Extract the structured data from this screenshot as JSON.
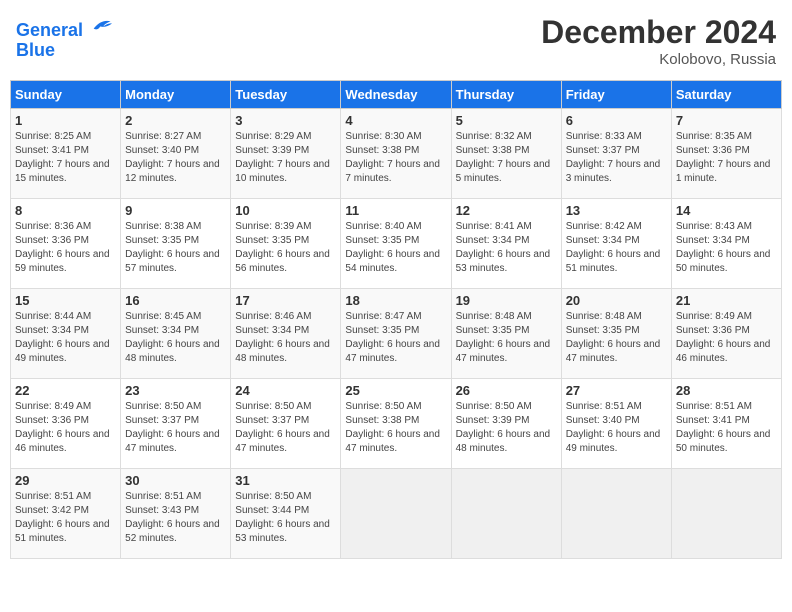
{
  "header": {
    "logo_line1": "General",
    "logo_line2": "Blue",
    "title": "December 2024",
    "subtitle": "Kolobovo, Russia"
  },
  "weekdays": [
    "Sunday",
    "Monday",
    "Tuesday",
    "Wednesday",
    "Thursday",
    "Friday",
    "Saturday"
  ],
  "weeks": [
    [
      {
        "day": "1",
        "sunrise": "Sunrise: 8:25 AM",
        "sunset": "Sunset: 3:41 PM",
        "daylight": "Daylight: 7 hours and 15 minutes."
      },
      {
        "day": "2",
        "sunrise": "Sunrise: 8:27 AM",
        "sunset": "Sunset: 3:40 PM",
        "daylight": "Daylight: 7 hours and 12 minutes."
      },
      {
        "day": "3",
        "sunrise": "Sunrise: 8:29 AM",
        "sunset": "Sunset: 3:39 PM",
        "daylight": "Daylight: 7 hours and 10 minutes."
      },
      {
        "day": "4",
        "sunrise": "Sunrise: 8:30 AM",
        "sunset": "Sunset: 3:38 PM",
        "daylight": "Daylight: 7 hours and 7 minutes."
      },
      {
        "day": "5",
        "sunrise": "Sunrise: 8:32 AM",
        "sunset": "Sunset: 3:38 PM",
        "daylight": "Daylight: 7 hours and 5 minutes."
      },
      {
        "day": "6",
        "sunrise": "Sunrise: 8:33 AM",
        "sunset": "Sunset: 3:37 PM",
        "daylight": "Daylight: 7 hours and 3 minutes."
      },
      {
        "day": "7",
        "sunrise": "Sunrise: 8:35 AM",
        "sunset": "Sunset: 3:36 PM",
        "daylight": "Daylight: 7 hours and 1 minute."
      }
    ],
    [
      {
        "day": "8",
        "sunrise": "Sunrise: 8:36 AM",
        "sunset": "Sunset: 3:36 PM",
        "daylight": "Daylight: 6 hours and 59 minutes."
      },
      {
        "day": "9",
        "sunrise": "Sunrise: 8:38 AM",
        "sunset": "Sunset: 3:35 PM",
        "daylight": "Daylight: 6 hours and 57 minutes."
      },
      {
        "day": "10",
        "sunrise": "Sunrise: 8:39 AM",
        "sunset": "Sunset: 3:35 PM",
        "daylight": "Daylight: 6 hours and 56 minutes."
      },
      {
        "day": "11",
        "sunrise": "Sunrise: 8:40 AM",
        "sunset": "Sunset: 3:35 PM",
        "daylight": "Daylight: 6 hours and 54 minutes."
      },
      {
        "day": "12",
        "sunrise": "Sunrise: 8:41 AM",
        "sunset": "Sunset: 3:34 PM",
        "daylight": "Daylight: 6 hours and 53 minutes."
      },
      {
        "day": "13",
        "sunrise": "Sunrise: 8:42 AM",
        "sunset": "Sunset: 3:34 PM",
        "daylight": "Daylight: 6 hours and 51 minutes."
      },
      {
        "day": "14",
        "sunrise": "Sunrise: 8:43 AM",
        "sunset": "Sunset: 3:34 PM",
        "daylight": "Daylight: 6 hours and 50 minutes."
      }
    ],
    [
      {
        "day": "15",
        "sunrise": "Sunrise: 8:44 AM",
        "sunset": "Sunset: 3:34 PM",
        "daylight": "Daylight: 6 hours and 49 minutes."
      },
      {
        "day": "16",
        "sunrise": "Sunrise: 8:45 AM",
        "sunset": "Sunset: 3:34 PM",
        "daylight": "Daylight: 6 hours and 48 minutes."
      },
      {
        "day": "17",
        "sunrise": "Sunrise: 8:46 AM",
        "sunset": "Sunset: 3:34 PM",
        "daylight": "Daylight: 6 hours and 48 minutes."
      },
      {
        "day": "18",
        "sunrise": "Sunrise: 8:47 AM",
        "sunset": "Sunset: 3:35 PM",
        "daylight": "Daylight: 6 hours and 47 minutes."
      },
      {
        "day": "19",
        "sunrise": "Sunrise: 8:48 AM",
        "sunset": "Sunset: 3:35 PM",
        "daylight": "Daylight: 6 hours and 47 minutes."
      },
      {
        "day": "20",
        "sunrise": "Sunrise: 8:48 AM",
        "sunset": "Sunset: 3:35 PM",
        "daylight": "Daylight: 6 hours and 47 minutes."
      },
      {
        "day": "21",
        "sunrise": "Sunrise: 8:49 AM",
        "sunset": "Sunset: 3:36 PM",
        "daylight": "Daylight: 6 hours and 46 minutes."
      }
    ],
    [
      {
        "day": "22",
        "sunrise": "Sunrise: 8:49 AM",
        "sunset": "Sunset: 3:36 PM",
        "daylight": "Daylight: 6 hours and 46 minutes."
      },
      {
        "day": "23",
        "sunrise": "Sunrise: 8:50 AM",
        "sunset": "Sunset: 3:37 PM",
        "daylight": "Daylight: 6 hours and 47 minutes."
      },
      {
        "day": "24",
        "sunrise": "Sunrise: 8:50 AM",
        "sunset": "Sunset: 3:37 PM",
        "daylight": "Daylight: 6 hours and 47 minutes."
      },
      {
        "day": "25",
        "sunrise": "Sunrise: 8:50 AM",
        "sunset": "Sunset: 3:38 PM",
        "daylight": "Daylight: 6 hours and 47 minutes."
      },
      {
        "day": "26",
        "sunrise": "Sunrise: 8:50 AM",
        "sunset": "Sunset: 3:39 PM",
        "daylight": "Daylight: 6 hours and 48 minutes."
      },
      {
        "day": "27",
        "sunrise": "Sunrise: 8:51 AM",
        "sunset": "Sunset: 3:40 PM",
        "daylight": "Daylight: 6 hours and 49 minutes."
      },
      {
        "day": "28",
        "sunrise": "Sunrise: 8:51 AM",
        "sunset": "Sunset: 3:41 PM",
        "daylight": "Daylight: 6 hours and 50 minutes."
      }
    ],
    [
      {
        "day": "29",
        "sunrise": "Sunrise: 8:51 AM",
        "sunset": "Sunset: 3:42 PM",
        "daylight": "Daylight: 6 hours and 51 minutes."
      },
      {
        "day": "30",
        "sunrise": "Sunrise: 8:51 AM",
        "sunset": "Sunset: 3:43 PM",
        "daylight": "Daylight: 6 hours and 52 minutes."
      },
      {
        "day": "31",
        "sunrise": "Sunrise: 8:50 AM",
        "sunset": "Sunset: 3:44 PM",
        "daylight": "Daylight: 6 hours and 53 minutes."
      },
      null,
      null,
      null,
      null
    ]
  ]
}
